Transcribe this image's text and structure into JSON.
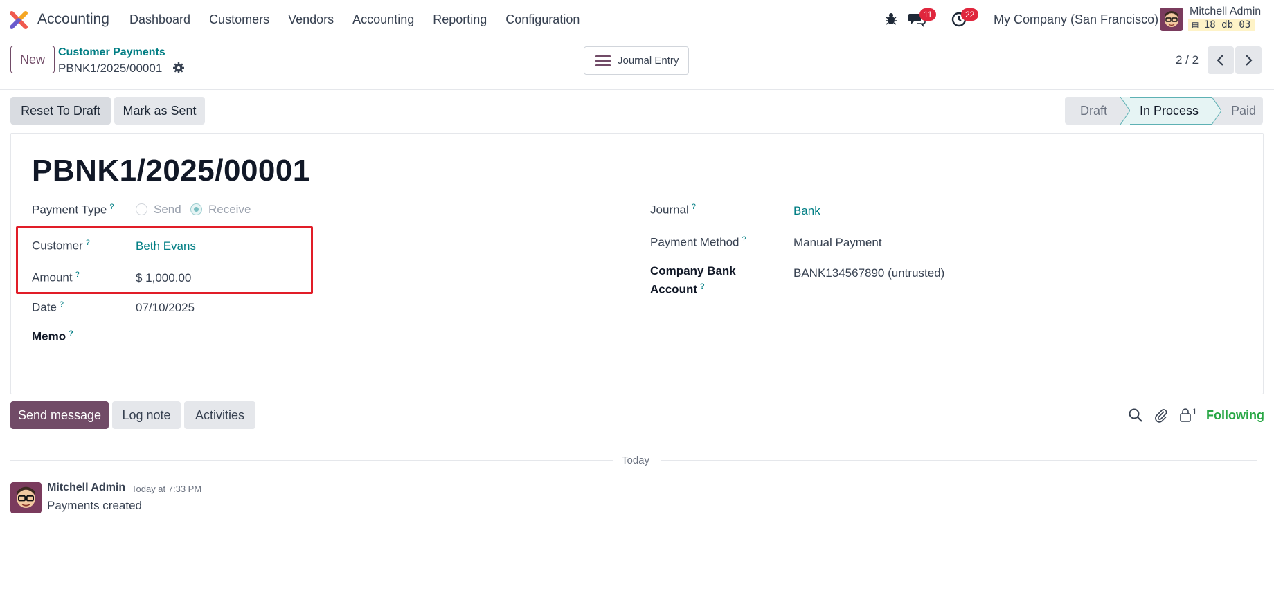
{
  "navbar": {
    "app_name": "Accounting",
    "menu": [
      "Dashboard",
      "Customers",
      "Vendors",
      "Accounting",
      "Reporting",
      "Configuration"
    ],
    "messages_badge": "11",
    "activities_badge": "22",
    "company": "My Company (San Francisco)",
    "user_name": "Mitchell Admin",
    "db_name": "18_db_03"
  },
  "control_panel": {
    "new_label": "New",
    "breadcrumb": "Customer Payments",
    "record_name": "PBNK1/2025/00001",
    "journal_entry_label": "Journal Entry",
    "pager": "2 / 2"
  },
  "actions": {
    "reset_label": "Reset To Draft",
    "mark_sent_label": "Mark as Sent"
  },
  "status": {
    "stages": [
      "Draft",
      "In Process",
      "Paid"
    ],
    "current": "In Process"
  },
  "form": {
    "title": "PBNK1/2025/00001",
    "payment_type_label": "Payment Type",
    "payment_type_options": [
      "Send",
      "Receive"
    ],
    "payment_type_selected": "Receive",
    "customer_label": "Customer",
    "customer_value": "Beth Evans",
    "amount_label": "Amount",
    "amount_value": "$ 1,000.00",
    "date_label": "Date",
    "date_value": "07/10/2025",
    "memo_label": "Memo",
    "journal_label": "Journal",
    "journal_value": "Bank",
    "payment_method_label": "Payment Method",
    "payment_method_value": "Manual Payment",
    "bank_account_label_1": "Company Bank",
    "bank_account_label_2": "Account",
    "bank_account_value": "BANK134567890 (untrusted)",
    "help_mark": "?"
  },
  "chatter": {
    "send_message_label": "Send message",
    "log_note_label": "Log note",
    "activities_label": "Activities",
    "follower_count": "1",
    "following_label": "Following",
    "day_separator": "Today",
    "message": {
      "author": "Mitchell Admin",
      "time": "Today at 7:33 PM",
      "body": "Payments created"
    }
  },
  "colors": {
    "brand": "#714b67",
    "link": "#017e84",
    "highlight": "#e11d28",
    "following": "#28a745",
    "badge": "#e0263d"
  }
}
